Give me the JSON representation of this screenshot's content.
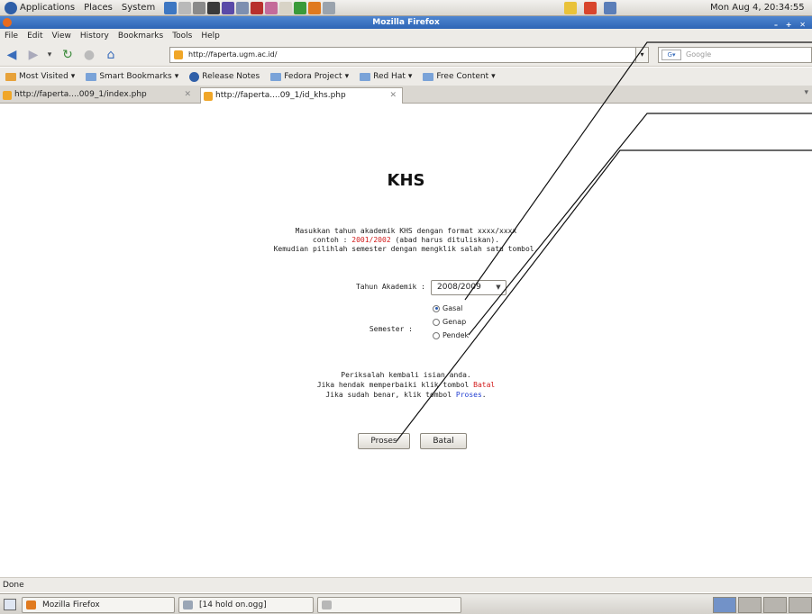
{
  "panel": {
    "menus": [
      "Applications",
      "Places",
      "System"
    ],
    "clock": "Mon Aug  4, 20:34:55"
  },
  "window": {
    "title": "Mozilla Firefox"
  },
  "menubar": [
    "File",
    "Edit",
    "View",
    "History",
    "Bookmarks",
    "Tools",
    "Help"
  ],
  "nav": {
    "url": "http://faperta.ugm.ac.id/",
    "search_placeholder": "Google"
  },
  "bookmarks": [
    "Most Visited",
    "Smart Bookmarks",
    "Release Notes",
    "Fedora Project",
    "Red Hat",
    "Free Content"
  ],
  "tabs": [
    {
      "title": "http://faperta....009_1/index.php"
    },
    {
      "title": "http://faperta....09_1/id_khs.php"
    }
  ],
  "page": {
    "heading": "KHS",
    "intro1": "Masukkan tahun akademik KHS dengan format xxxx/xxxx",
    "intro2_prefix": "contoh : ",
    "intro2_example": "2001/2002",
    "intro2_suffix": " (abad harus dituliskan).",
    "intro3": "Kemudian pilihlah semester dengan mengklik salah satu tombol.",
    "year_label": "Tahun Akademik :",
    "year_value": "2008/2009",
    "semester_label": "Semester :",
    "semester_options": [
      "Gasal",
      "Genap",
      "Pendek"
    ],
    "semester_selected": "Gasal",
    "check1": "Periksalah kembali isian anda.",
    "check2_prefix": "Jika hendak memperbaiki klik tombol ",
    "check2_link": "Batal",
    "check3_prefix": "Jika sudah benar, klik tombol ",
    "check3_link": "Proses",
    "check3_suffix": ".",
    "proses_button": "Proses",
    "batal_button": "Batal"
  },
  "status": "Done",
  "taskbar": [
    "Mozilla Firefox",
    "[14 hold on.ogg]"
  ]
}
